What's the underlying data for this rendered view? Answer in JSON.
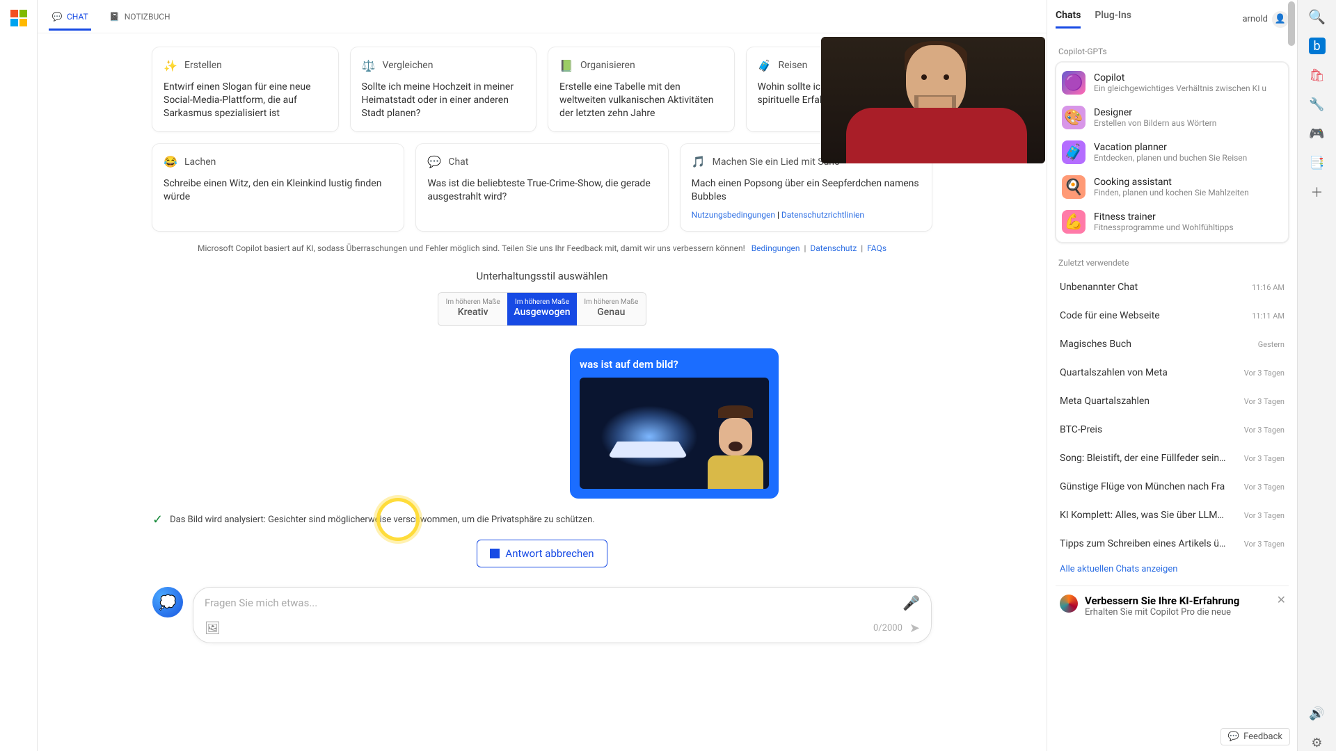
{
  "topTabs": {
    "chat": "CHAT",
    "notebook": "NOTIZBUCH"
  },
  "suggestions": {
    "row1": [
      {
        "icon": "✨",
        "title": "Erstellen",
        "body": "Entwirf einen Slogan für eine neue Social-Media-Plattform, die auf Sarkasmus spezialisiert ist"
      },
      {
        "icon": "⚖️",
        "title": "Vergleichen",
        "body": "Sollte ich meine Hochzeit in meiner Heimatstadt oder in einer anderen Stadt planen?"
      },
      {
        "icon": "📗",
        "title": "Organisieren",
        "body": "Erstelle eine Tabelle mit den weltweiten vulkanischen Aktivitäten der letzten zehn Jahre"
      },
      {
        "icon": "🧳",
        "title": "Reisen",
        "body": "Wohin sollte ich reisen, eine spirituelle Erfahrun möchte?"
      }
    ],
    "row2": [
      {
        "icon": "😂",
        "title": "Lachen",
        "body": "Schreibe einen Witz, den ein Kleinkind lustig finden würde"
      },
      {
        "icon": "💬",
        "title": "Chat",
        "body": "Was ist die beliebteste True-Crime-Show, die gerade ausgestrahlt wird?"
      },
      {
        "icon": "🎵",
        "title": "Machen Sie ein Lied mit Suno",
        "body": "Mach einen Popsong über ein Seepferdchen namens Bubbles"
      }
    ]
  },
  "legalLinks": {
    "terms": "Nutzungsbedingungen",
    "privacy": "Datenschutzrichtlinien"
  },
  "disclaimer": {
    "text": "Microsoft Copilot basiert auf KI, sodass Überraschungen und Fehler möglich sind. Teilen Sie uns Ihr Feedback mit, damit wir uns verbessern können!",
    "l1": "Bedingungen",
    "l2": "Datenschutz",
    "l3": "FAQs"
  },
  "styleSection": {
    "title": "Unterhaltungsstil auswählen",
    "pre": "Im höheren Maße",
    "opts": [
      "Kreativ",
      "Ausgewogen",
      "Genau"
    ]
  },
  "userMessage": {
    "question": "was ist auf dem bild?"
  },
  "status": {
    "text": "Das Bild wird analysiert: Gesichter sind möglicherweise verschwommen, um die Privatsphäre zu schützen."
  },
  "stopButton": "Antwort abbrechen",
  "composer": {
    "placeholder": "Fragen Sie mich etwas...",
    "counter": "0/2000"
  },
  "rightPanel": {
    "tabs": {
      "chats": "Chats",
      "plugins": "Plug-Ins"
    },
    "user": "arnold",
    "gptTitle": "Copilot-GPTs",
    "gpts": [
      {
        "emoji": "🟣",
        "name": "Copilot",
        "sub": "Ein gleichgewichtiges Verhältnis zwischen KI u"
      },
      {
        "emoji": "🎨",
        "name": "Designer",
        "sub": "Erstellen von Bildern aus Wörtern"
      },
      {
        "emoji": "🧳",
        "name": "Vacation planner",
        "sub": "Entdecken, planen und buchen Sie Reisen"
      },
      {
        "emoji": "🍳",
        "name": "Cooking assistant",
        "sub": "Finden, planen und kochen Sie Mahlzeiten"
      },
      {
        "emoji": "💪",
        "name": "Fitness trainer",
        "sub": "Fitnessprogramme und Wohlfühltipps"
      }
    ],
    "recentTitle": "Zuletzt verwendete",
    "recent": [
      {
        "name": "Unbenannter Chat",
        "date": "11:16 AM"
      },
      {
        "name": "Code für eine Webseite",
        "date": "11:11 AM"
      },
      {
        "name": "Magisches Buch",
        "date": "Gestern"
      },
      {
        "name": "Quartalszahlen von Meta",
        "date": "Vor 3 Tagen"
      },
      {
        "name": "Meta Quartalszahlen",
        "date": "Vor 3 Tagen"
      },
      {
        "name": "BTC-Preis",
        "date": "Vor 3 Tagen"
      },
      {
        "name": "Song: Bleistift, der eine Füllfeder sein m",
        "date": "Vor 3 Tagen"
      },
      {
        "name": "Günstige Flüge von München nach Fra",
        "date": "Vor 3 Tagen"
      },
      {
        "name": "KI Komplett: Alles, was Sie über LLMs u",
        "date": "Vor 3 Tagen"
      },
      {
        "name": "Tipps zum Schreiben eines Artikels übe",
        "date": "Vor 3 Tagen"
      }
    ],
    "viewAll": "Alle aktuellen Chats anzeigen",
    "promo": {
      "title": "Verbessern Sie Ihre KI-Erfahrung",
      "sub": "Erhalten Sie mit Copilot Pro die neue"
    }
  },
  "feedback": "Feedback"
}
